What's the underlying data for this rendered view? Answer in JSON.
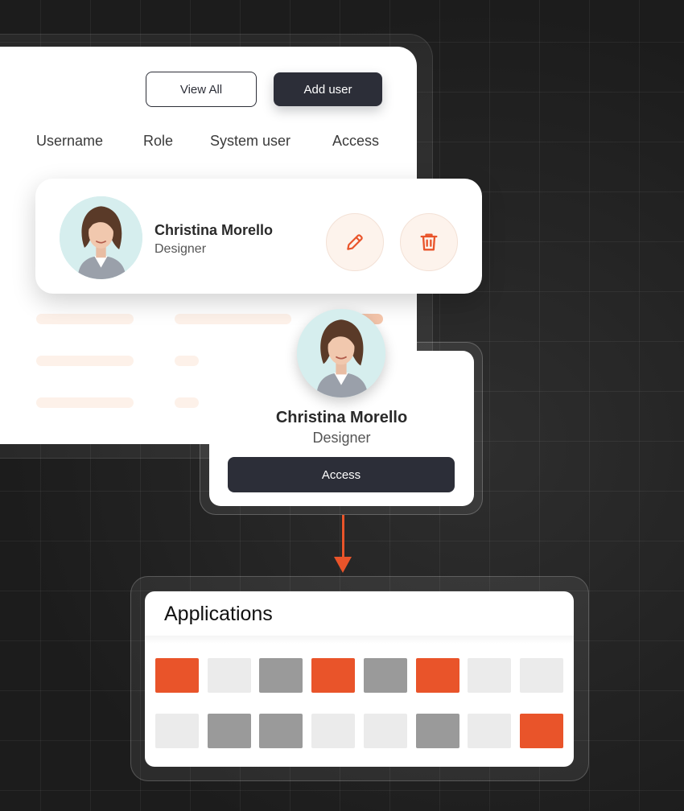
{
  "toolbar": {
    "view_all_label": "View All",
    "add_user_label": "Add user"
  },
  "table": {
    "columns": [
      "Username",
      "Role",
      "System user",
      "Access"
    ]
  },
  "user_row": {
    "name": "Christina Morello",
    "role": "Designer",
    "edit_icon": "pencil-icon",
    "delete_icon": "trash-icon"
  },
  "profile_popup": {
    "name": "Christina Morello",
    "role": "Designer",
    "access_label": "Access"
  },
  "applications": {
    "title": "Applications",
    "rows": [
      [
        "orange",
        "light",
        "dark",
        "orange",
        "dark",
        "orange",
        "light",
        "light"
      ],
      [
        "light",
        "dark",
        "dark",
        "light",
        "light",
        "dark",
        "light",
        "orange"
      ]
    ]
  },
  "colors": {
    "accent": "#e9542a",
    "dark_button": "#2c2e38",
    "tile_orange": "#e9542a",
    "tile_dark": "#9a9a9a",
    "tile_light": "#ebebeb"
  }
}
